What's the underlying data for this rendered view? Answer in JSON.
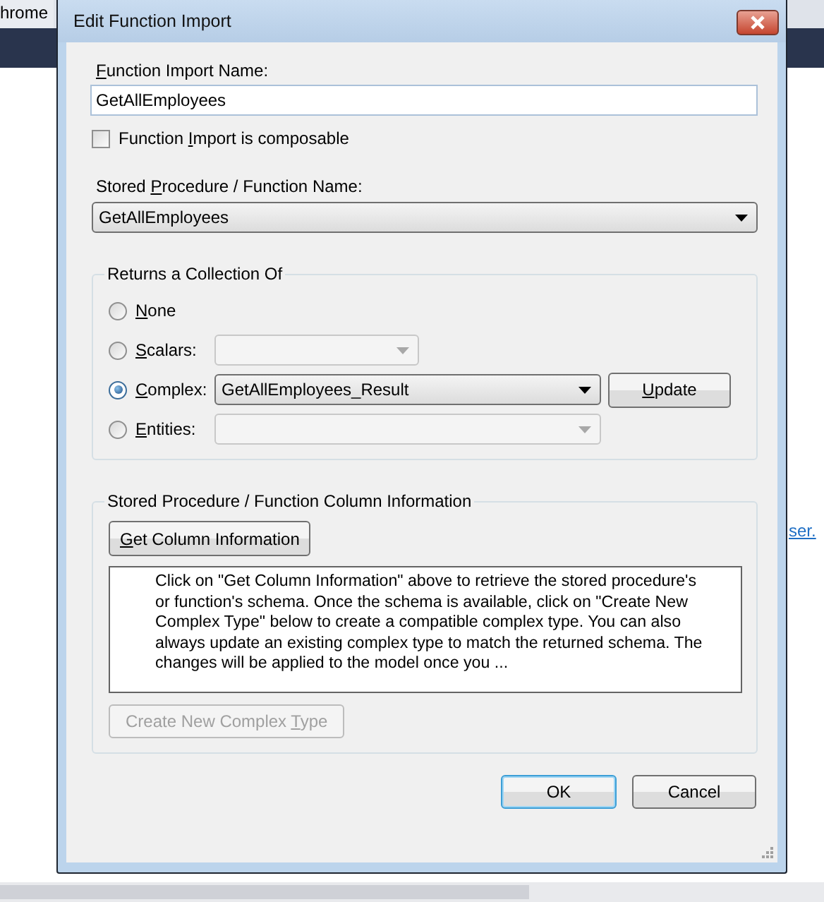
{
  "browser": {
    "tab_label": "hrome",
    "link": "ser."
  },
  "dialog": {
    "title": "Edit Function Import",
    "name_label": {
      "key": "F",
      "post": "unction Import Name:"
    },
    "name_value": "GetAllEmployees",
    "composable": {
      "label": {
        "pre": "Function ",
        "key": "I",
        "post": "mport is composable"
      },
      "checked": false
    },
    "procedure_label": {
      "pre": "Stored ",
      "key": "P",
      "post": "rocedure / Function Name:"
    },
    "procedure_value": "GetAllEmployees",
    "returns": {
      "title": "Returns a Collection Of",
      "options": [
        {
          "kind": "plain",
          "label": {
            "key": "N",
            "post": "one"
          },
          "selected": false
        },
        {
          "kind": "short-combo",
          "label": {
            "key": "S",
            "post": "calars:"
          },
          "selected": false,
          "disabled": true
        },
        {
          "kind": "combo",
          "label": {
            "key": "C",
            "post": "omplex:"
          },
          "selected": true,
          "disabled": false,
          "value": "GetAllEmployees_Result",
          "button": {
            "key": "U",
            "post": "pdate"
          }
        },
        {
          "kind": "combo",
          "label": {
            "key": "E",
            "post": "ntities:"
          },
          "selected": false,
          "disabled": true
        }
      ]
    },
    "columns": {
      "title": "Stored Procedure / Function Column Information",
      "get_button": {
        "label": {
          "key": "G",
          "post": "et Column Information"
        },
        "disabled": false
      },
      "info": "Click on \"Get Column Information\" above to retrieve the stored procedure's or function's schema. Once the schema is available, click on \"Create New Complex Type\" below to create a compatible complex type. You can also always update an existing complex type to match the returned schema. The changes will be applied to the model once you ...",
      "create_button": {
        "label": {
          "pre": "Create New Complex ",
          "key": "T",
          "post": "ype"
        },
        "disabled": true
      }
    },
    "buttons": [
      {
        "label": "OK",
        "default": true
      },
      {
        "label": "Cancel",
        "default": false
      }
    ]
  }
}
